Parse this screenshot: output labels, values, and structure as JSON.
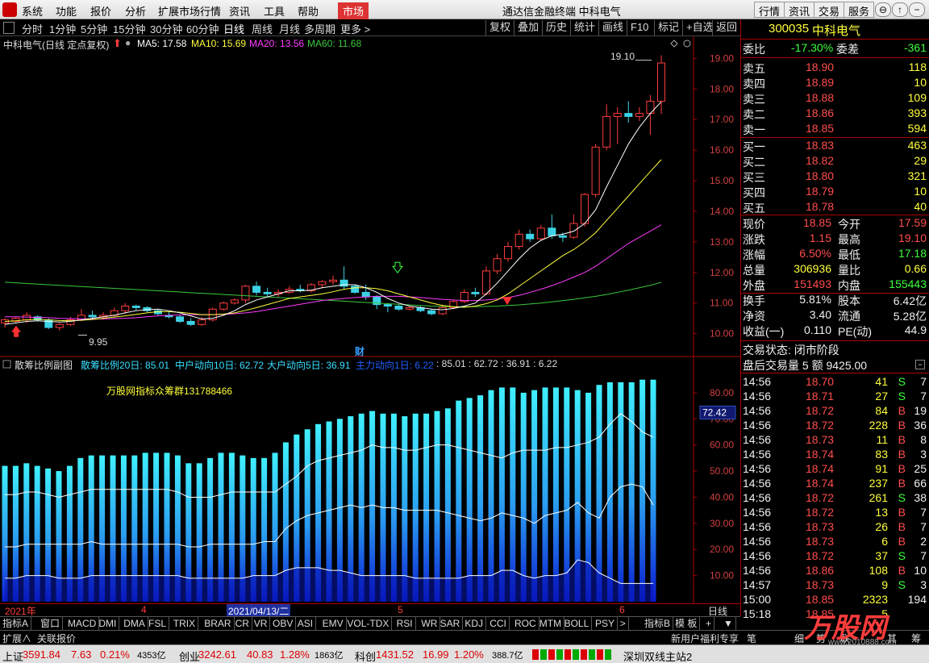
{
  "menu": {
    "items": [
      "系统",
      "功能",
      "报价",
      "分析",
      "扩展市场行情",
      "资讯",
      "工具",
      "帮助"
    ],
    "active": "市场",
    "title": "通达信金融终端  中科电气",
    "right_buttons": [
      "行情",
      "资讯",
      "交易",
      "服务"
    ],
    "window_buttons": [
      "⊖",
      "↑",
      "−",
      "□",
      "×"
    ]
  },
  "periods": [
    "分时",
    "1分钟",
    "5分钟",
    "15分钟",
    "30分钟",
    "60分钟",
    "日线",
    "周线",
    "月线",
    "多周期",
    "更多 >"
  ],
  "period_selected": "日线",
  "toolbar_buttons": [
    "复权",
    "叠加",
    "历史",
    "统计",
    "画线",
    "F10",
    "标记",
    "+自选",
    "返回"
  ],
  "main": {
    "header_name": "中科电气(日线 定点复权)",
    "ma5": "MA5: 17.58",
    "ma10": "MA10: 15.69",
    "ma20": "MA20: 13.56",
    "ma60": "MA60: 11.68",
    "high_label": "19.10",
    "low_label": "9.95",
    "cai": "财",
    "yticks": [
      "19.00",
      "18.00",
      "17.00",
      "16.00",
      "15.00",
      "14.00",
      "13.00",
      "12.00",
      "11.00",
      "10.00"
    ],
    "colors": {
      "ma5": "#ffffff",
      "ma10": "#ffff3c",
      "ma20": "#ff3cff",
      "ma60": "#3cc83c",
      "up": "#ff3c3c",
      "down": "#3cd2e6"
    }
  },
  "sub": {
    "name": "散筹比例副图",
    "l1": "散筹比例20日: 85.01",
    "l2": "中户动向10日: 62.72",
    "l3": "大户动向5日: 36.91",
    "l4": "主力动向1日: 6.22",
    "l5": ": 85.01 : 62.72 : 36.91 : 6.22",
    "ad": "万股网指标众筹群131788466",
    "current": "72.42",
    "yticks": [
      "80.00",
      "70.00",
      "60.00",
      "50.00",
      "40.00",
      "30.00",
      "20.00",
      "10.00"
    ]
  },
  "xaxis": {
    "labels": [
      "2021年",
      "4",
      "2021/04/13/二",
      "5",
      "6"
    ],
    "period": "日线"
  },
  "chart_data": {
    "type": "candlestick",
    "title": "中科电气(日线 定点复权)",
    "ylim": [
      9.7,
      19.3
    ],
    "candles": [
      [
        10.35,
        10.45,
        10.2,
        10.5
      ],
      [
        10.4,
        10.5,
        10.35,
        10.55
      ],
      [
        10.45,
        10.6,
        10.35,
        10.7
      ],
      [
        10.55,
        10.45,
        10.4,
        10.6
      ],
      [
        10.45,
        10.2,
        10.15,
        10.5
      ],
      [
        10.2,
        10.3,
        10.1,
        10.35
      ],
      [
        10.3,
        10.45,
        10.25,
        10.55
      ],
      [
        10.45,
        10.6,
        10.4,
        10.8
      ],
      [
        10.6,
        10.55,
        10.45,
        10.75
      ],
      [
        10.55,
        10.6,
        10.45,
        10.7
      ],
      [
        10.6,
        10.75,
        10.55,
        10.85
      ],
      [
        10.75,
        10.9,
        10.65,
        11.0
      ],
      [
        10.9,
        10.85,
        10.75,
        10.95
      ],
      [
        10.85,
        10.75,
        10.7,
        10.9
      ],
      [
        10.75,
        10.65,
        10.6,
        10.8
      ],
      [
        10.6,
        10.55,
        10.5,
        10.7
      ],
      [
        10.55,
        10.4,
        10.35,
        10.6
      ],
      [
        10.4,
        10.3,
        10.25,
        10.5
      ],
      [
        10.3,
        10.45,
        10.25,
        10.55
      ],
      [
        10.45,
        10.8,
        10.4,
        10.85
      ],
      [
        10.8,
        11.0,
        10.75,
        11.05
      ],
      [
        11.0,
        11.1,
        10.95,
        11.15
      ],
      [
        11.1,
        11.55,
        11.0,
        11.6
      ],
      [
        11.55,
        11.35,
        11.25,
        11.7
      ],
      [
        11.35,
        11.3,
        11.2,
        11.5
      ],
      [
        11.3,
        11.35,
        11.2,
        11.45
      ],
      [
        11.35,
        11.45,
        11.3,
        11.55
      ],
      [
        11.45,
        11.4,
        11.35,
        11.6
      ],
      [
        11.4,
        11.6,
        11.35,
        11.65
      ],
      [
        11.6,
        11.7,
        11.5,
        11.75
      ],
      [
        11.7,
        11.75,
        11.6,
        11.9
      ],
      [
        11.75,
        11.55,
        11.45,
        12.2
      ],
      [
        11.55,
        11.35,
        11.3,
        11.6
      ],
      [
        11.35,
        11.2,
        11.1,
        11.6
      ],
      [
        11.2,
        10.95,
        10.8,
        11.25
      ],
      [
        10.95,
        10.9,
        10.7,
        11.0
      ],
      [
        10.9,
        10.8,
        10.75,
        10.95
      ],
      [
        10.8,
        10.85,
        10.75,
        10.9
      ],
      [
        10.85,
        10.75,
        10.7,
        10.9
      ],
      [
        10.75,
        10.65,
        10.6,
        10.8
      ],
      [
        10.65,
        10.85,
        10.6,
        10.95
      ],
      [
        10.85,
        11.05,
        10.8,
        11.1
      ],
      [
        11.05,
        11.35,
        11.0,
        11.45
      ],
      [
        11.35,
        11.3,
        11.2,
        11.5
      ],
      [
        11.3,
        12.05,
        11.25,
        12.2
      ],
      [
        12.05,
        12.45,
        11.95,
        12.6
      ],
      [
        12.45,
        12.85,
        12.35,
        13.0
      ],
      [
        12.85,
        13.25,
        12.75,
        13.4
      ],
      [
        13.25,
        13.1,
        13.0,
        13.4
      ],
      [
        13.1,
        13.45,
        13.05,
        13.55
      ],
      [
        13.45,
        13.2,
        13.1,
        13.9
      ],
      [
        13.2,
        13.15,
        13.0,
        13.3
      ],
      [
        13.15,
        13.6,
        13.1,
        13.9
      ],
      [
        13.6,
        14.55,
        13.5,
        14.6
      ],
      [
        14.55,
        16.1,
        14.45,
        16.2
      ],
      [
        16.1,
        17.1,
        16.0,
        17.5
      ],
      [
        17.1,
        17.2,
        16.2,
        17.4
      ],
      [
        17.2,
        17.1,
        16.9,
        17.6
      ],
      [
        17.1,
        17.2,
        16.95,
        17.4
      ],
      [
        17.2,
        17.6,
        16.5,
        17.8
      ],
      [
        17.6,
        18.85,
        17.18,
        19.1
      ]
    ],
    "ma5": [
      10.3,
      10.35,
      10.4,
      10.42,
      10.4,
      10.38,
      10.4,
      10.45,
      10.5,
      10.55,
      10.6,
      10.68,
      10.75,
      10.78,
      10.8,
      10.75,
      10.68,
      10.58,
      10.48,
      10.5,
      10.6,
      10.75,
      10.95,
      11.1,
      11.2,
      11.3,
      11.4,
      11.4,
      11.42,
      11.5,
      11.55,
      11.6,
      11.6,
      11.5,
      11.35,
      11.15,
      11.0,
      10.9,
      10.85,
      10.8,
      10.78,
      10.82,
      10.9,
      11.0,
      11.3,
      11.65,
      12.05,
      12.45,
      12.8,
      13.05,
      13.2,
      13.25,
      13.35,
      13.6,
      14.05,
      14.8,
      15.5,
      16.2,
      16.75,
      17.2,
      17.58
    ],
    "ma10": [
      10.4,
      10.42,
      10.45,
      10.47,
      10.45,
      10.43,
      10.42,
      10.44,
      10.46,
      10.5,
      10.54,
      10.58,
      10.63,
      10.68,
      10.72,
      10.72,
      10.7,
      10.66,
      10.62,
      10.62,
      10.64,
      10.68,
      10.76,
      10.85,
      10.95,
      11.05,
      11.15,
      11.2,
      11.25,
      11.3,
      11.37,
      11.45,
      11.5,
      11.5,
      11.47,
      11.4,
      11.3,
      11.2,
      11.1,
      11.0,
      10.92,
      10.88,
      10.86,
      10.9,
      10.98,
      11.1,
      11.3,
      11.55,
      11.8,
      12.05,
      12.3,
      12.55,
      12.75,
      13.0,
      13.3,
      13.7,
      14.1,
      14.5,
      14.9,
      15.3,
      15.69
    ],
    "ma20": [
      10.55,
      10.55,
      10.54,
      10.53,
      10.52,
      10.5,
      10.49,
      10.48,
      10.48,
      10.48,
      10.49,
      10.5,
      10.52,
      10.55,
      10.58,
      10.6,
      10.61,
      10.62,
      10.62,
      10.62,
      10.63,
      10.65,
      10.68,
      10.72,
      10.78,
      10.84,
      10.9,
      10.96,
      11.02,
      11.08,
      11.12,
      11.15,
      11.18,
      11.2,
      11.22,
      11.22,
      11.22,
      11.2,
      11.18,
      11.15,
      11.12,
      11.1,
      11.08,
      11.08,
      11.1,
      11.13,
      11.18,
      11.25,
      11.35,
      11.45,
      11.57,
      11.7,
      11.85,
      12.0,
      12.2,
      12.45,
      12.7,
      12.95,
      13.15,
      13.35,
      13.56
    ],
    "ma60": [
      11.68,
      11.66,
      11.64,
      11.62,
      11.6,
      11.58,
      11.56,
      11.54,
      11.52,
      11.5,
      11.48,
      11.46,
      11.44,
      11.42,
      11.4,
      11.38,
      11.36,
      11.34,
      11.32,
      11.3,
      11.28,
      11.26,
      11.24,
      11.22,
      11.2,
      11.18,
      11.16,
      11.14,
      11.12,
      11.1,
      11.08,
      11.06,
      11.04,
      11.02,
      11.0,
      10.98,
      10.96,
      10.94,
      10.92,
      10.9,
      10.89,
      10.88,
      10.88,
      10.88,
      10.89,
      10.9,
      10.92,
      10.94,
      10.97,
      11.0,
      11.04,
      11.08,
      11.12,
      11.17,
      11.22,
      11.28,
      11.35,
      11.42,
      11.5,
      11.58,
      11.68
    ],
    "sub_ylim": [
      0,
      88
    ],
    "bars": [
      52,
      52,
      53,
      52,
      51,
      50,
      52,
      55,
      56,
      56,
      56,
      56,
      56,
      57,
      57,
      57,
      56,
      53,
      53,
      55,
      57,
      57,
      56,
      55,
      55,
      57,
      61,
      64,
      66,
      68,
      69,
      70,
      71,
      72,
      73,
      72,
      72,
      71,
      72,
      72,
      73,
      74,
      77,
      78,
      79,
      81,
      82,
      82,
      80,
      81,
      82,
      82,
      82,
      81,
      80,
      83,
      84,
      84,
      84,
      85,
      85
    ],
    "white_mid": [
      41,
      41,
      42,
      42,
      41,
      40,
      41,
      42,
      43,
      43,
      43,
      43,
      43,
      43,
      43,
      43,
      42,
      40,
      40,
      40,
      41,
      42,
      42,
      42,
      42,
      42,
      45,
      48,
      52,
      54,
      55,
      56,
      57,
      58,
      60,
      59,
      59,
      58,
      58,
      59,
      60,
      60,
      59,
      58,
      57,
      56,
      55,
      57,
      58,
      58,
      58,
      59,
      59,
      60,
      61,
      63,
      68,
      72,
      69,
      65,
      63
    ],
    "white_low": [
      21,
      21,
      22,
      22,
      22,
      22,
      22,
      22,
      23,
      22,
      22,
      22,
      22,
      22,
      22,
      22,
      22,
      21,
      21,
      22,
      22,
      22,
      22,
      22,
      23,
      23,
      28,
      31,
      33,
      34,
      35,
      36,
      37,
      36,
      37,
      36,
      36,
      35,
      35,
      35,
      35,
      34,
      33,
      32,
      31,
      32,
      34,
      33,
      32,
      30,
      33,
      34,
      35,
      38,
      34,
      32,
      40,
      44,
      45,
      44,
      37
    ],
    "white_bot": [
      9,
      9,
      10,
      10,
      10,
      9,
      9,
      9,
      10,
      10,
      10,
      10,
      10,
      10,
      10,
      10,
      10,
      9,
      9,
      9,
      9,
      9,
      9,
      10,
      10,
      10,
      12,
      13,
      13,
      13,
      12,
      12,
      11,
      10,
      10,
      10,
      10,
      10,
      9,
      9,
      9,
      9,
      9,
      10,
      10,
      10,
      12,
      12,
      10,
      9,
      10,
      10,
      11,
      16,
      15,
      11,
      9,
      7,
      7,
      7,
      7
    ]
  },
  "quote": {
    "code": "300035",
    "name": "中科电气",
    "wb_label": "委比",
    "wb": "-17.30%",
    "wc_label": "委差",
    "wc": "-361",
    "asks": [
      [
        "卖五",
        "18.90",
        "118"
      ],
      [
        "卖四",
        "18.89",
        "10"
      ],
      [
        "卖三",
        "18.88",
        "109"
      ],
      [
        "卖二",
        "18.86",
        "393"
      ],
      [
        "卖一",
        "18.85",
        "594"
      ]
    ],
    "bids": [
      [
        "买一",
        "18.83",
        "463"
      ],
      [
        "买二",
        "18.82",
        "29"
      ],
      [
        "买三",
        "18.80",
        "321"
      ],
      [
        "买四",
        "18.79",
        "10"
      ],
      [
        "买五",
        "18.78",
        "40"
      ]
    ],
    "stats": [
      [
        "现价",
        "18.85",
        "今开",
        "17.59"
      ],
      [
        "涨跌",
        "1.15",
        "最高",
        "19.10"
      ],
      [
        "涨幅",
        "6.50%",
        "最低",
        "17.18"
      ],
      [
        "总量",
        "306936",
        "量比",
        "0.66"
      ],
      [
        "外盘",
        "151493",
        "内盘",
        "155443"
      ],
      [
        "换手",
        "5.81%",
        "股本",
        "6.42亿"
      ],
      [
        "净资",
        "3.40",
        "流通",
        "5.28亿"
      ],
      [
        "收益(一)",
        "0.110",
        "PE(动)",
        "44.9"
      ]
    ],
    "state": "交易状态: 闭市阶段",
    "after": "盘后交易量 5 额 9425.00",
    "ticks": [
      [
        "14:56",
        "18.70",
        "41",
        "S",
        "7"
      ],
      [
        "14:56",
        "18.71",
        "27",
        "S",
        "7"
      ],
      [
        "14:56",
        "18.72",
        "84",
        "B",
        "19"
      ],
      [
        "14:56",
        "18.72",
        "228",
        "B",
        "36"
      ],
      [
        "14:56",
        "18.73",
        "11",
        "B",
        "8"
      ],
      [
        "14:56",
        "18.74",
        "83",
        "B",
        "3"
      ],
      [
        "14:56",
        "18.74",
        "91",
        "B",
        "25"
      ],
      [
        "14:56",
        "18.74",
        "237",
        "B",
        "66"
      ],
      [
        "14:56",
        "18.72",
        "261",
        "S",
        "38"
      ],
      [
        "14:56",
        "18.72",
        "13",
        "B",
        "7"
      ],
      [
        "14:56",
        "18.73",
        "26",
        "B",
        "7"
      ],
      [
        "14:56",
        "18.73",
        "6",
        "B",
        "2"
      ],
      [
        "14:56",
        "18.72",
        "37",
        "S",
        "7"
      ],
      [
        "14:56",
        "18.86",
        "108",
        "B",
        "10"
      ],
      [
        "14:57",
        "18.73",
        "9",
        "S",
        "3"
      ],
      [
        "15:00",
        "18.85",
        "2323",
        "",
        "194"
      ],
      [
        "15:18",
        "18.85",
        "5",
        "",
        ""
      ]
    ]
  },
  "bottom_tabs": [
    "指标A",
    "窗口",
    "MACD",
    "DMI",
    "DMA",
    "FSL",
    "TRIX",
    "BRAR",
    "CR",
    "VR",
    "OBV",
    "ASI",
    "EMV",
    "VOL-TDX",
    "RSI",
    "WR",
    "SAR",
    "KDJ",
    "CCI",
    "ROC",
    "MTM",
    "BOLL",
    "PSY",
    ">"
  ],
  "bottom_right_tabs": [
    "指标B",
    "模 板",
    "+",
    "▼"
  ],
  "bottom2": {
    "expand": "扩展∧",
    "quote": "关联报价",
    "promo": "新用户福利专享",
    "pen": "笔",
    "fine": "细",
    "trend": "势",
    "link": "联",
    "misc": "其",
    "more": "筹"
  },
  "status": {
    "sh": "上证",
    "sh_v": "3591.84",
    "sh_c": "7.63",
    "sh_p": "0.21%",
    "sh_a": "4353亿",
    "cy": "创业",
    "cy_v": "3242.61",
    "cy_c": "40.83",
    "cy_p": "1.28%",
    "cy_a": "1863亿",
    "kc": "科创",
    "kc_v": "1431.52",
    "kc_c": "16.99",
    "kc_p": "1.20%",
    "kc_a": "388.7亿",
    "server": "深圳双线主站2"
  },
  "watermark": {
    "brand": "万股网",
    "url": "www.2010888.com"
  }
}
